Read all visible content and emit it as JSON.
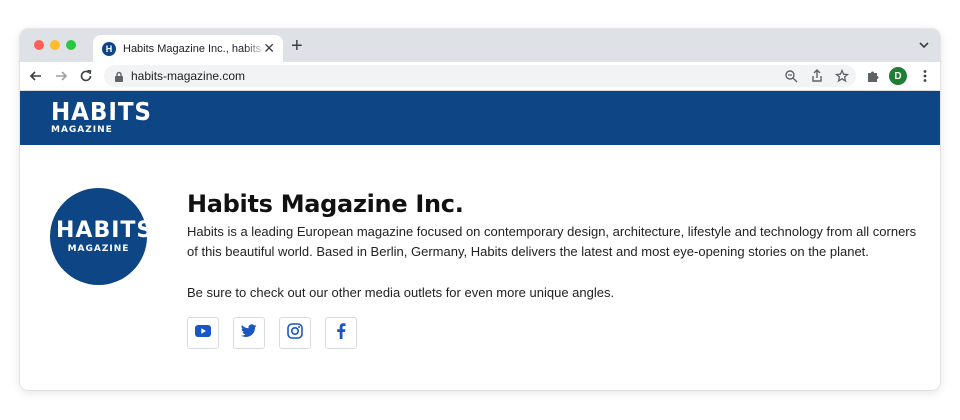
{
  "browser": {
    "tab_title": "Habits Magazine Inc., habits-magazine.com",
    "tab_favicon_letter": "H",
    "url": "habits-magazine.com",
    "profile_initial": "D"
  },
  "header": {
    "logo_main": "HABITS",
    "logo_sub": "MAGAZINE"
  },
  "profile": {
    "logo_main": "HABITS",
    "logo_sub": "MAGAZINE",
    "name": "Habits Magazine Inc.",
    "description": "Habits is a leading European magazine focused on contemporary design, architecture, lifestyle and technology from all corners of this beautiful world. Based in Berlin, Germany, Habits delivers the latest and most eye-opening stories on the planet.",
    "cta": "Be sure to check out our other media outlets for even more unique angles."
  },
  "socials": [
    "youtube-icon",
    "twitter-icon",
    "instagram-icon",
    "facebook-icon"
  ],
  "colors": {
    "brand": "#0d4585",
    "social_icon": "#1a56c4",
    "profile_avatar": "#1e7e34"
  }
}
